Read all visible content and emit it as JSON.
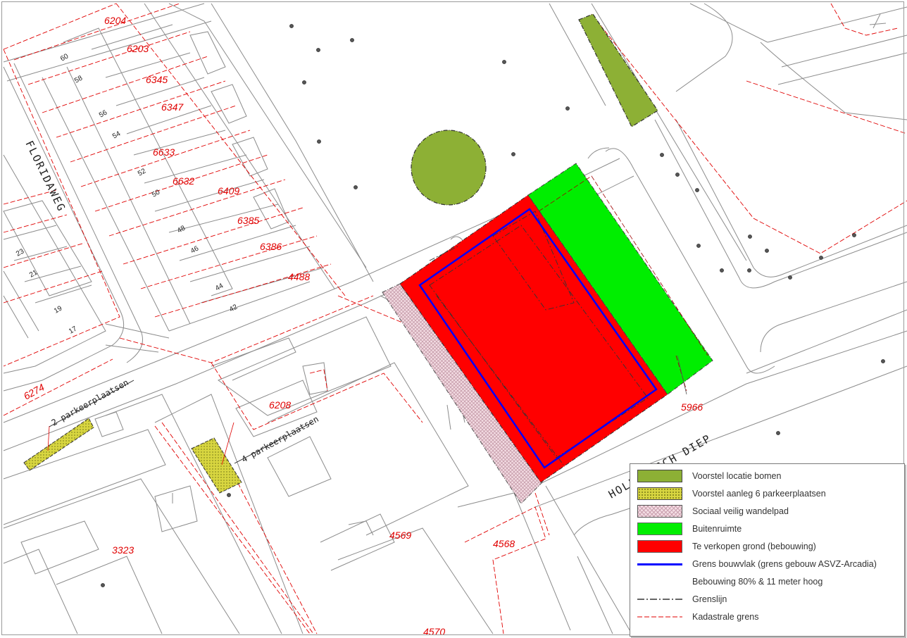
{
  "street_labels": {
    "floridaweg": "FLORIDAWEG",
    "hollandsch_diep": "HOLLANDSCH DIEP"
  },
  "parcel_numbers": [
    "6204",
    "6203",
    "6345",
    "6347",
    "6633",
    "6632",
    "6409",
    "6385",
    "6386",
    "4488",
    "6274",
    "6208",
    "5966",
    "4569",
    "4568",
    "3323",
    "4570"
  ],
  "house_numbers": [
    "60",
    "58",
    "56",
    "54",
    "52",
    "50",
    "48",
    "46",
    "44",
    "42",
    "23",
    "21",
    "19",
    "17"
  ],
  "parking_labels": {
    "left": "2 parkeerplaatsen",
    "right": "4 parkeerplaatsen"
  },
  "legend": {
    "items": [
      {
        "label": "Voorstel locatie bomen",
        "swatch": "fill",
        "color": "#8db035"
      },
      {
        "label": "Voorstel aanleg 6 parkeerplaatsen",
        "swatch": "dotted",
        "color": "#d8d640"
      },
      {
        "label": "Sociaal veilig wandelpad",
        "swatch": "hatched",
        "color": "#f4dde4"
      },
      {
        "label": "Buitenruimte",
        "swatch": "fill",
        "color": "#00ee00"
      },
      {
        "label": "Te verkopen grond (bebouwing)",
        "swatch": "fill",
        "color": "#ff0000"
      },
      {
        "label": "Grens bouwvlak (grens gebouw ASVZ-Arcadia)",
        "swatch": "line",
        "color": "#0000ff"
      },
      {
        "label": "Bebouwing 80% & 11 meter hoog",
        "swatch": "none",
        "color": ""
      },
      {
        "label": "Grenslijn",
        "swatch": "dash-dot",
        "color": "#333333"
      },
      {
        "label": "Kadastrale grens",
        "swatch": "dashed",
        "color": "#e00000"
      }
    ]
  },
  "colors": {
    "trees": "#8db035",
    "parking": "#d8d640",
    "footpath": "#f4dde4",
    "outdoor_space": "#00ee00",
    "land_for_sale": "#ff0000",
    "building_plane": "#0000ff",
    "cadastral": "#e00000",
    "base_lines": "#8c8c8c"
  }
}
